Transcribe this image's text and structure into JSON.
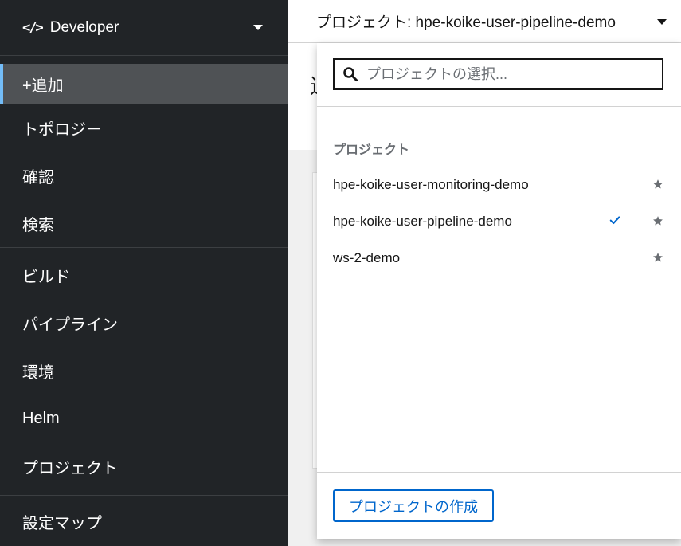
{
  "perspective": {
    "label": "Developer"
  },
  "sidebar": {
    "group1": [
      {
        "label": "+追加",
        "active": true
      },
      {
        "label": "トポロジー"
      },
      {
        "label": "確認"
      },
      {
        "label": "検索"
      }
    ],
    "group2": [
      {
        "label": "ビルド"
      },
      {
        "label": "パイプライン"
      },
      {
        "label": "環境"
      },
      {
        "label": "Helm"
      },
      {
        "label": "プロジェクト"
      }
    ],
    "group3": [
      {
        "label": "設定マップ"
      }
    ]
  },
  "topbar": {
    "project_label": "プロジェクト: hpe-koike-user-pipeline-demo"
  },
  "background": {
    "title_peek": "追"
  },
  "dropdown": {
    "search_placeholder": "プロジェクトの選択...",
    "group_title": "プロジェクト",
    "projects": [
      {
        "name": "hpe-koike-user-monitoring-demo",
        "selected": false
      },
      {
        "name": "hpe-koike-user-pipeline-demo",
        "selected": true
      },
      {
        "name": "ws-2-demo",
        "selected": false
      }
    ],
    "create_button": "プロジェクトの作成"
  },
  "colors": {
    "sidebar_bg": "#212427",
    "active_item": "#4f5255",
    "accent": "#0066cc",
    "active_marker": "#73bcf7"
  }
}
